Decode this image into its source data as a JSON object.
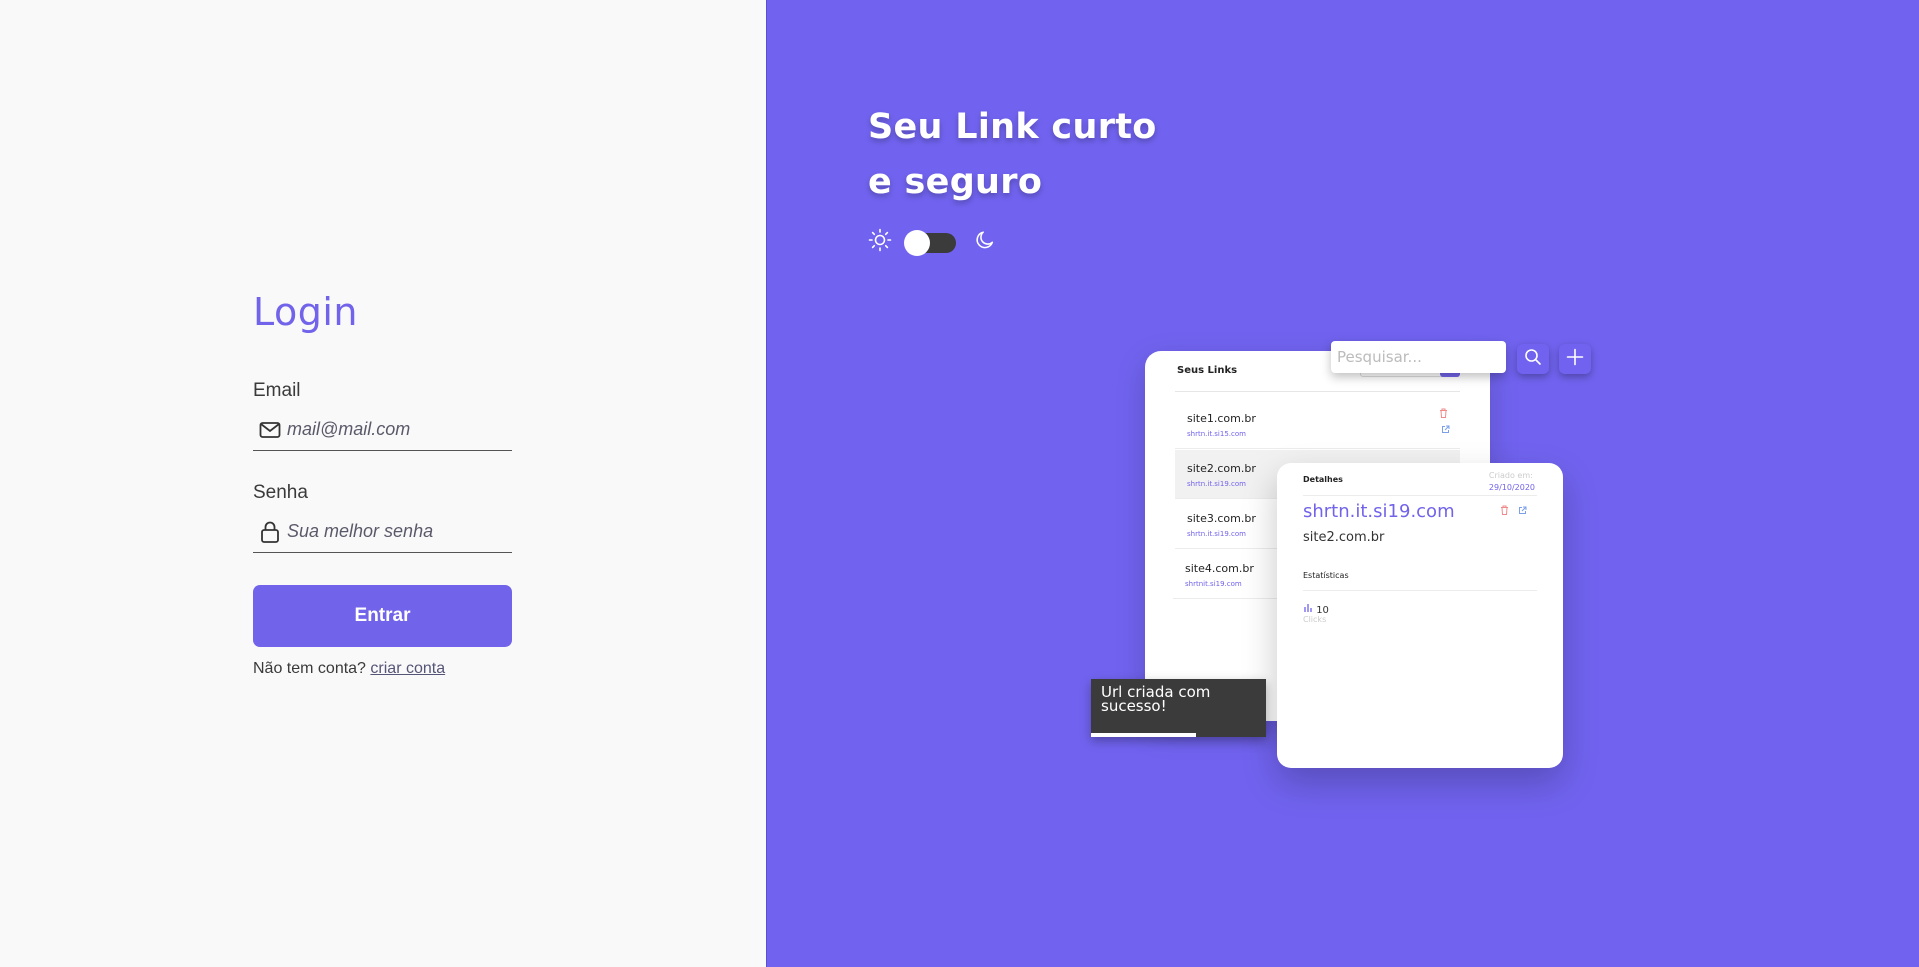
{
  "login": {
    "title": "Login",
    "email_label": "Email",
    "email_placeholder": "mail@mail.com",
    "password_label": "Senha",
    "password_placeholder": "Sua melhor senha",
    "submit_label": "Entrar",
    "no_account_text": "Não tem conta?",
    "create_account_link": "criar conta"
  },
  "hero": {
    "headline_line1": "Seu Link curto",
    "headline_line2": "e seguro",
    "theme": {
      "light_icon": "sun-icon",
      "dark_icon": "moon-icon",
      "mode": "light"
    }
  },
  "mockup": {
    "links_card": {
      "title": "Seus Links",
      "items": [
        {
          "domain": "site1.com.br",
          "short": "shrtn.it.si15.com"
        },
        {
          "domain": "site2.com.br",
          "short": "shrtn.it.si19.com"
        },
        {
          "domain": "site3.com.br",
          "short": "shrtn.it.si19.com"
        },
        {
          "domain": "site4.com.br",
          "short": "shrtnit.si19.com"
        }
      ]
    },
    "search": {
      "placeholder": "Pesquisar..."
    },
    "details_card": {
      "title": "Detalhes",
      "created_label": "Criado em:",
      "created_date": "29/10/2020",
      "short_url": "shrtn.it.si19.com",
      "original": "site2.com.br",
      "stats_label": "Estatísticas",
      "clicks_value": "10",
      "clicks_label": "Clicks"
    },
    "toast": {
      "message": "Url criada com sucesso!",
      "progress": 0.6
    }
  },
  "colors": {
    "accent": "#7163ea",
    "panel": "#7163ef",
    "background": "#faf9f9",
    "toast": "#3b3b3b"
  }
}
